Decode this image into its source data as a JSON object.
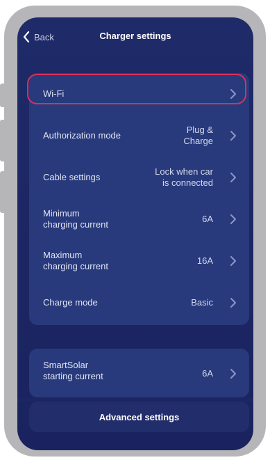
{
  "header": {
    "back_label": "Back",
    "title": "Charger settings"
  },
  "settings": [
    {
      "label": "Wi-Fi",
      "value": ""
    },
    {
      "label": "Authorization mode",
      "value": "Plug &\nCharge"
    },
    {
      "label": "Cable settings",
      "value": "Lock when car\nis connected"
    },
    {
      "label": "Minimum\ncharging current",
      "value": "6A"
    },
    {
      "label": "Maximum\ncharging current",
      "value": "16A"
    },
    {
      "label": "Charge mode",
      "value": "Basic"
    }
  ],
  "smartsolar": {
    "label": "SmartSolar\nstarting current",
    "value": "6A"
  },
  "advanced_label": "Advanced settings",
  "colors": {
    "highlight": "#d8315b",
    "card": "#283a7c",
    "background": "#1f2a69"
  },
  "icons": {
    "back": "chevron-left-icon",
    "row": "chevron-right-icon"
  }
}
